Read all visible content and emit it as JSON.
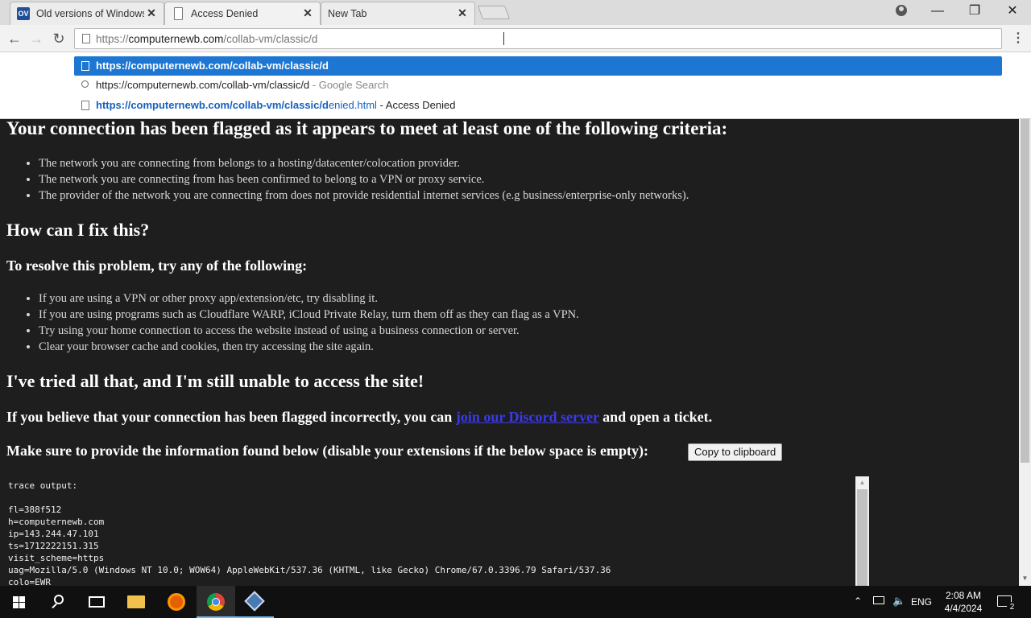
{
  "tabs": [
    {
      "title": "Old versions of Windows",
      "favicon": "ov-favicon"
    },
    {
      "title": "Access Denied",
      "favicon": "page-icon"
    },
    {
      "title": "New Tab",
      "favicon": ""
    }
  ],
  "tab_close_glyph": "✕",
  "window_controls": {
    "minimize": "—",
    "restore": "❐",
    "close": "✕"
  },
  "omnibox": {
    "value": "https://computernewb.com/collab-vm/classic/d",
    "scheme": "https://",
    "host": "computernewb.com",
    "path": "/collab-vm/classic/d"
  },
  "suggestions": [
    {
      "text": "https://computernewb.com/collab-vm/classic/d",
      "extra": ""
    },
    {
      "text": "https://computernewb.com/collab-vm/classic/d",
      "extra": " - Google Search"
    },
    {
      "url_bold": "https://computernewb.com/collab-vm/classic/d",
      "url_rest": "enied.html",
      "extra": " - Access Denied"
    }
  ],
  "content": {
    "criteria_heading": "Your connection has been flagged as it appears to meet at least one of the following criteria:",
    "criteria": [
      "The network you are connecting from belongs to a hosting/datacenter/colocation provider.",
      "The network you are connecting from has been confirmed to belong to a VPN or proxy service.",
      "The provider of the network you are connecting from does not provide residential internet services (e.g business/enterprise-only networks)."
    ],
    "fix_heading": "How can I fix this?",
    "resolve_heading": "To resolve this problem, try any of the following:",
    "fixes": [
      "If you are using a VPN or other proxy app/extension/etc, try disabling it.",
      "If you are using programs such as Cloudflare WARP, iCloud Private Relay, turn them off as they can flag as a VPN.",
      "Try using your home connection to access the website instead of using a business connection or server.",
      "Clear your browser cache and cookies, then try accessing the site again."
    ],
    "tried_heading": "I've tried all that, and I'm still unable to access the site!",
    "believe_pre": "If you believe that your connection has been flagged incorrectly, you can ",
    "discord_link": "join our Discord server",
    "believe_post": " and open a ticket.",
    "provide_text": "Make sure to provide the information found below (disable your extensions if the below space is empty):",
    "copy_button": "Copy to clipboard",
    "trace": "trace output:\n\nfl=388f512\nh=computernewb.com\nip=143.244.47.101\nts=1712222151.315\nvisit_scheme=https\nuag=Mozilla/5.0 (Windows NT 10.0; WOW64) AppleWebKit/537.36 (KHTML, like Gecko) Chrome/67.0.3396.79 Safari/537.36\ncolo=EWR"
  },
  "taskbar": {
    "language": "ENG",
    "time": "2:08 AM",
    "date": "4/4/2024",
    "notification_count": "2"
  }
}
